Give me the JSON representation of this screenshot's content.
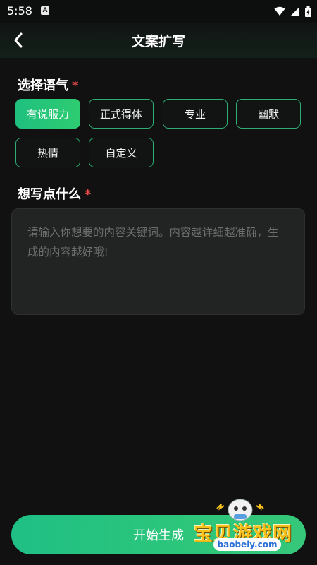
{
  "status_bar": {
    "time": "5:58",
    "notification_icon": "A"
  },
  "header": {
    "title": "文案扩写",
    "back_icon": "chevron-left-icon"
  },
  "tone_section": {
    "label": "选择语气",
    "required_mark": "*",
    "options": [
      {
        "label": "有说服力",
        "selected": true
      },
      {
        "label": "正式得体",
        "selected": false
      },
      {
        "label": "专业",
        "selected": false
      },
      {
        "label": "幽默",
        "selected": false
      },
      {
        "label": "热情",
        "selected": false
      },
      {
        "label": "自定义",
        "selected": false
      }
    ]
  },
  "input_section": {
    "label": "想写点什么",
    "required_mark": "*",
    "placeholder": "请输入你想要的内容关键词。内容越详细越准确，生成的内容越好哦!"
  },
  "actions": {
    "start_label": "开始生成"
  },
  "watermark": {
    "brand": "宝贝游戏网",
    "url": "baobeiy.com"
  },
  "colors": {
    "accent": "#2ecc71",
    "required": "#e84a4a",
    "background": "#101110"
  }
}
